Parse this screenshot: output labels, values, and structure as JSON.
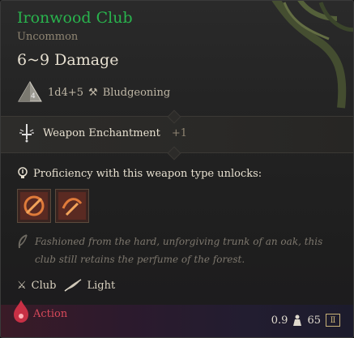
{
  "item": {
    "name": "Ironwood Club",
    "rarity": "Uncommon",
    "damage": "6~9 Damage",
    "dice": "1d4+5",
    "damage_type": "Bludgeoning",
    "enchantment_label": "Weapon Enchantment",
    "enchantment_value": "+1",
    "proficiency_text": "Proficiency with this weapon type unlocks:",
    "flavor_text": "Fashioned from the hard, unforgiving trunk of an oak, this club still retains the perfume of the forest.",
    "weapon_type": "Club",
    "weight_class": "Light",
    "action_label": "Action",
    "weight": "0.9",
    "value": "65"
  },
  "icons": {
    "dice": "d4-die-icon",
    "damage_type": "hammer-icon",
    "enchantment": "enchant-sword-icon",
    "proficiency": "lightbulb-icon",
    "flavor": "quill-icon",
    "weapon_type": "crossed-weapons-icon",
    "weight_class": "feather-icon",
    "action": "action-drop-icon",
    "weight": "weight-icon",
    "value": "gold-coin-icon"
  },
  "colors": {
    "title": "#29b34d",
    "rarity": "#8f8572",
    "action": "#d8495a",
    "footer_start": "#3a1b27",
    "footer_end": "#1c1b2c",
    "coin": "#c8b277"
  }
}
